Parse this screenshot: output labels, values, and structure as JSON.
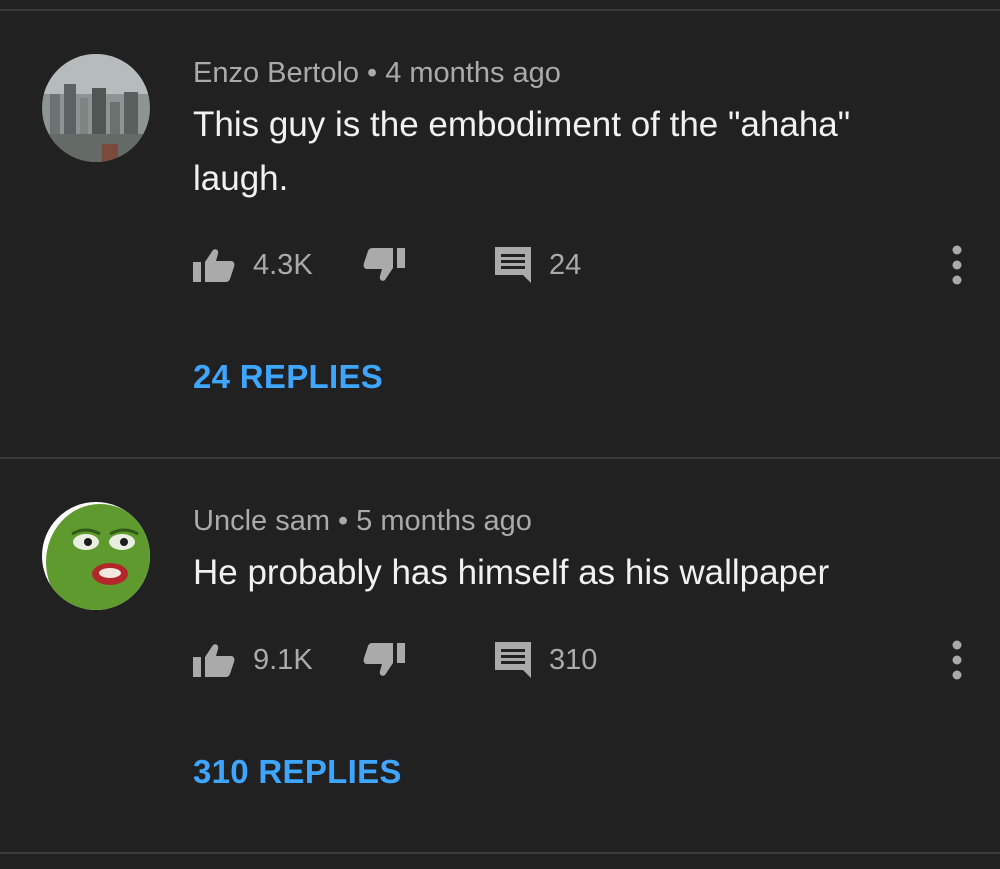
{
  "comments": [
    {
      "author": "Enzo Bertolo",
      "separator": "•",
      "time": "4 months ago",
      "text": "This guy is the embodiment of the \"ahaha\" laugh.",
      "likes": "4.3K",
      "reply_count": "24",
      "replies_label": "24 REPLIES",
      "avatar_icon": "city-photo-avatar"
    },
    {
      "author": "Uncle sam",
      "separator": "•",
      "time": "5 months ago",
      "text": "He probably has himself as his wallpaper",
      "likes": "9.1K",
      "reply_count": "310",
      "replies_label": "310 REPLIES",
      "avatar_icon": "frog-face-avatar"
    }
  ],
  "colors": {
    "background": "#212121",
    "text_primary": "#f1f1f1",
    "text_secondary": "#aaaaaa",
    "link_blue": "#3ea6ff",
    "divider": "#3a3a3a"
  }
}
